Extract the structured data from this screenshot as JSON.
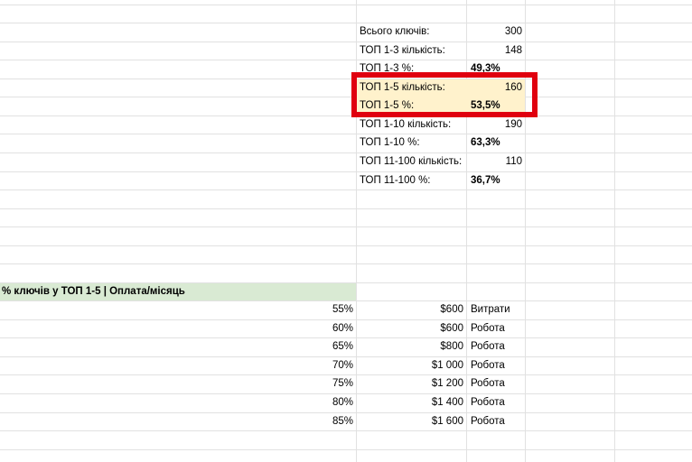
{
  "summary": {
    "rows": [
      {
        "label": "Всього ключів:",
        "value": "300",
        "bold": false
      },
      {
        "label": "ТОП 1-3 кількість:",
        "value": "148",
        "bold": false
      },
      {
        "label": "ТОП 1-3 %:",
        "value": "49,3%",
        "bold": true
      },
      {
        "label": "ТОП 1-5 кількість:",
        "value": "160",
        "bold": false,
        "highlighted": true
      },
      {
        "label": "ТОП 1-5 %:",
        "value": "53,5%",
        "bold": true,
        "highlighted": true
      },
      {
        "label": "ТОП 1-10 кількість:",
        "value": "190",
        "bold": false
      },
      {
        "label": "ТОП 1-10 %:",
        "value": "63,3%",
        "bold": true
      },
      {
        "label": "ТОП 11-100 кількість:",
        "value": "110",
        "bold": false
      },
      {
        "label": "ТОП 11-100 %:",
        "value": "36,7%",
        "bold": true
      }
    ]
  },
  "pricing": {
    "header": "% ключів у ТОП 1-5 | Оплата/місяць",
    "rows": [
      {
        "percent": "55%",
        "payment": "$600",
        "note": "Витрати"
      },
      {
        "percent": "60%",
        "payment": "$600",
        "note": "Робота"
      },
      {
        "percent": "65%",
        "payment": "$800",
        "note": "Робота"
      },
      {
        "percent": "70%",
        "payment": "$1 000",
        "note": "Робота"
      },
      {
        "percent": "75%",
        "payment": "$1 200",
        "note": "Робота"
      },
      {
        "percent": "80%",
        "payment": "$1 400",
        "note": "Робота"
      },
      {
        "percent": "85%",
        "payment": "$1 600",
        "note": "Робота"
      }
    ]
  },
  "colors": {
    "highlight": "#fff2cc",
    "header_fill": "#d9ead3",
    "annotation_border": "#e0000f",
    "gridline": "#e1e1e1"
  }
}
